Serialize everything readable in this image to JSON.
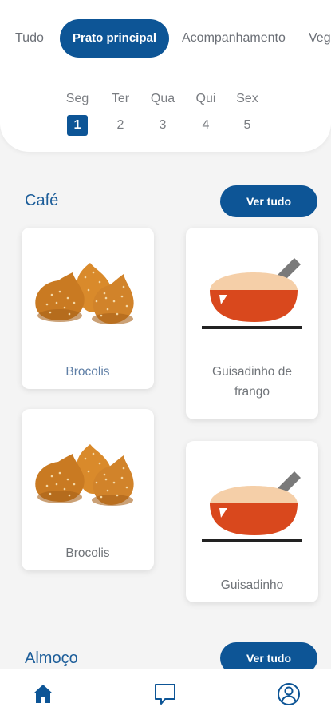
{
  "tabs": [
    {
      "label": "Tudo",
      "active": false
    },
    {
      "label": "Prato principal",
      "active": true
    },
    {
      "label": "Acompanhamento",
      "active": false
    },
    {
      "label": "Vegetariano",
      "active": false
    }
  ],
  "days": [
    {
      "name": "Seg",
      "num": "1",
      "active": true
    },
    {
      "name": "Ter",
      "num": "2",
      "active": false
    },
    {
      "name": "Qua",
      "num": "3",
      "active": false
    },
    {
      "name": "Qui",
      "num": "4",
      "active": false
    },
    {
      "name": "Sex",
      "num": "5",
      "active": false
    }
  ],
  "sections": {
    "cafe": {
      "title": "Café",
      "button": "Ver tudo",
      "items": [
        {
          "name": "Brocolis",
          "icon": "fried-snack-icon"
        },
        {
          "name": "Guisadinho de frango",
          "icon": "cooking-pot-icon"
        },
        {
          "name": "Brocolis",
          "icon": "fried-snack-icon"
        },
        {
          "name": "Guisadinho",
          "icon": "cooking-pot-icon"
        }
      ]
    },
    "almoco": {
      "title": "Almoço",
      "button": "Ver tudo"
    }
  },
  "nav": [
    {
      "icon": "home-icon",
      "active": true
    },
    {
      "icon": "chat-icon",
      "active": false
    },
    {
      "icon": "profile-icon",
      "active": false
    }
  ],
  "colors": {
    "primary": "#0d5596",
    "title": "#1c5d99",
    "background": "#f4f4f4"
  }
}
